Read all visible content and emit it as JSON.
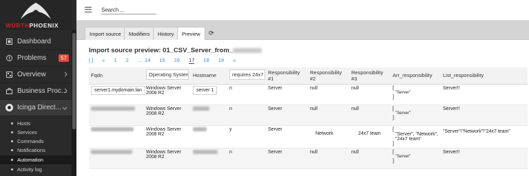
{
  "brand": {
    "word1": "WÜRTH",
    "word2": "PHOENIX",
    "accent": "#d21f26"
  },
  "sidebar": {
    "items": [
      {
        "label": "Dashboard",
        "icon": "dashboard-icon"
      },
      {
        "label": "Problems",
        "icon": "problems-icon",
        "badge": "57"
      },
      {
        "label": "Overview",
        "icon": "overview-icon"
      },
      {
        "label": "Business Proc...",
        "icon": "briefcase-icon"
      },
      {
        "label": "Icinga Direct...",
        "icon": "icinga-logo-icon"
      }
    ],
    "subitems": [
      "Hosts",
      "Services",
      "Commands",
      "Notifications",
      "Automation",
      "Activity log"
    ]
  },
  "header": {
    "search_placeholder": "Search ..."
  },
  "tabs": [
    "Import source",
    "Modifiers",
    "History",
    "Preview",
    "⟳"
  ],
  "title": "Import source preview: 01_CSV_Server_from_",
  "pager": [
    "[.]",
    "«",
    "1",
    "2",
    "...",
    "14",
    "15",
    "16",
    "17",
    "18",
    "19",
    "»"
  ],
  "table": {
    "headers": [
      "Fqdn",
      "Operating System",
      "Hostname",
      "requires 24x7",
      "Responsibility #1",
      "Responsibility #2",
      "Responsibility #3",
      "Arr_responsibility",
      "List_responsibility"
    ],
    "rows": [
      {
        "fqdn": "server1.mydomain.lan",
        "os": "Windows Server 2008 R2",
        "hostname": "server 1",
        "r247": "n",
        "r1": "Server",
        "r2": "null",
        "r3": "null",
        "arr_open": "[",
        "arr_body": "\"Server\"",
        "arr_close": "]",
        "list": "Server!!"
      },
      {
        "fqdn": "",
        "os": "Windows Server 2008 R2",
        "hostname": "",
        "r247": "n",
        "r1": "Server",
        "r2": "null",
        "r3": "null",
        "arr_open": "[",
        "arr_body": "\"Server\"",
        "arr_close": "]",
        "list": "Server!!"
      },
      {
        "fqdn": "",
        "os": "Windows Server 2008 R2",
        "hostname": "",
        "r247": "y",
        "r1": "Server",
        "r2": "Network",
        "r3": "24x7 team",
        "arr_open": "[",
        "arr_body": "\"Server\", \"Network\", \"24x7 team\"",
        "arr_close": "]",
        "list": "\"Server\"!\"Network\"!\"24x7 team\""
      },
      {
        "fqdn": "",
        "os": "Windows Server 2008 R2",
        "hostname": "",
        "r247": "n",
        "r1": "Server",
        "r2": "null",
        "r3": "null",
        "arr_open": "[",
        "arr_body": "\"Server\"",
        "arr_close": "]",
        "list": "Server!!"
      }
    ]
  }
}
